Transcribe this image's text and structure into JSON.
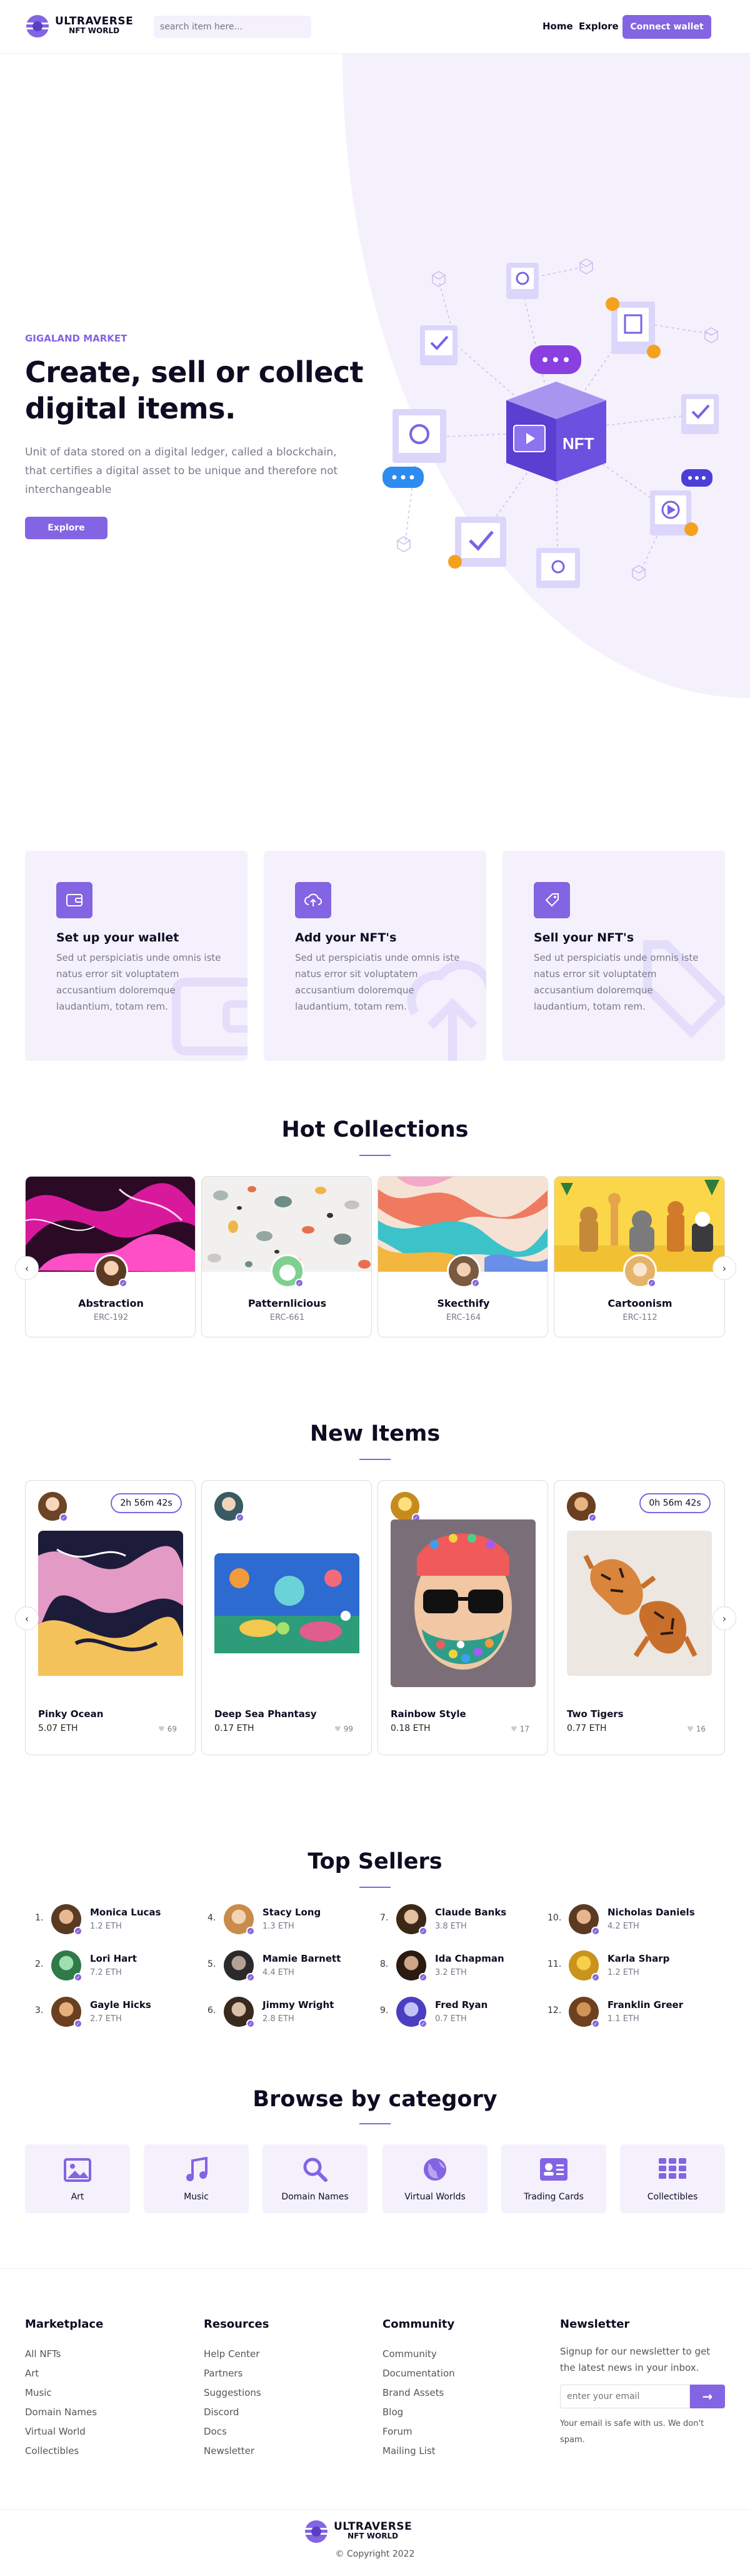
{
  "brand": {
    "line1": "ULTRAVERSE",
    "line2": "NFT WORLD"
  },
  "header": {
    "search_placeholder": "search item here...",
    "nav": [
      "Home",
      "Explore"
    ],
    "connect": "Connect wallet"
  },
  "hero": {
    "eyebrow": "GIGALAND MARKET",
    "title_line1": "Create, sell or collect",
    "title_line2": "digital items.",
    "desc": "Unit of data stored on a digital ledger, called a blockchain, that certifies a digital asset to be unique and therefore not interchangeable",
    "button": "Explore",
    "illustration_label": "NFT"
  },
  "features": [
    {
      "title": "Set up your wallet",
      "icon": "wallet-icon",
      "desc": "Sed ut perspiciatis unde omnis iste natus error sit voluptatem accusantium doloremque laudantium, totam rem."
    },
    {
      "title": "Add your NFT's",
      "icon": "cloud-upload-icon",
      "desc": "Sed ut perspiciatis unde omnis iste natus error sit voluptatem accusantium doloremque laudantium, totam rem."
    },
    {
      "title": "Sell your NFT's",
      "icon": "tag-icon",
      "desc": "Sed ut perspiciatis unde omnis iste natus error sit voluptatem accusantium doloremque laudantium, totam rem."
    }
  ],
  "hot": {
    "title": "Hot Collections",
    "items": [
      {
        "name": "Abstraction",
        "sub": "ERC-192"
      },
      {
        "name": "Patternlicious",
        "sub": "ERC-661"
      },
      {
        "name": "Skecthify",
        "sub": "ERC-164"
      },
      {
        "name": "Cartoonism",
        "sub": "ERC-112"
      }
    ]
  },
  "new_items": {
    "title": "New Items",
    "items": [
      {
        "name": "Pinky Ocean",
        "price": "5.07 ETH",
        "likes": "69",
        "timer": "2h 56m 42s"
      },
      {
        "name": "Deep Sea Phantasy",
        "price": "0.17 ETH",
        "likes": "99",
        "timer": ""
      },
      {
        "name": "Rainbow Style",
        "price": "0.18 ETH",
        "likes": "17",
        "timer": ""
      },
      {
        "name": "Two Tigers",
        "price": "0.77 ETH",
        "likes": "16",
        "timer": "0h 56m 42s"
      }
    ]
  },
  "sellers": {
    "title": "Top Sellers",
    "items": [
      {
        "rank": "1.",
        "name": "Monica Lucas",
        "eth": "1.2 ETH"
      },
      {
        "rank": "2.",
        "name": "Lori Hart",
        "eth": "7.2 ETH"
      },
      {
        "rank": "3.",
        "name": "Gayle Hicks",
        "eth": "2.7 ETH"
      },
      {
        "rank": "4.",
        "name": "Stacy Long",
        "eth": "1.3 ETH"
      },
      {
        "rank": "5.",
        "name": "Mamie Barnett",
        "eth": "4.4 ETH"
      },
      {
        "rank": "6.",
        "name": "Jimmy Wright",
        "eth": "2.8 ETH"
      },
      {
        "rank": "7.",
        "name": "Claude Banks",
        "eth": "3.8 ETH"
      },
      {
        "rank": "8.",
        "name": "Ida Chapman",
        "eth": "3.2 ETH"
      },
      {
        "rank": "9.",
        "name": "Fred Ryan",
        "eth": "0.7 ETH"
      },
      {
        "rank": "10.",
        "name": "Nicholas Daniels",
        "eth": "4.2 ETH"
      },
      {
        "rank": "11.",
        "name": "Karla Sharp",
        "eth": "1.2 ETH"
      },
      {
        "rank": "12.",
        "name": "Franklin Greer",
        "eth": "1.1 ETH"
      }
    ]
  },
  "categories": {
    "title": "Browse by category",
    "items": [
      {
        "label": "Art",
        "icon": "image-icon"
      },
      {
        "label": "Music",
        "icon": "music-icon"
      },
      {
        "label": "Domain Names",
        "icon": "search-icon"
      },
      {
        "label": "Virtual Worlds",
        "icon": "globe-icon"
      },
      {
        "label": "Trading Cards",
        "icon": "id-card-icon"
      },
      {
        "label": "Collectibles",
        "icon": "grid-icon"
      }
    ]
  },
  "footer": {
    "cols": [
      {
        "title": "Marketplace",
        "links": [
          "All NFTs",
          "Art",
          "Music",
          "Domain Names",
          "Virtual World",
          "Collectibles"
        ]
      },
      {
        "title": "Resources",
        "links": [
          "Help Center",
          "Partners",
          "Suggestions",
          "Discord",
          "Docs",
          "Newsletter"
        ]
      },
      {
        "title": "Community",
        "links": [
          "Community",
          "Documentation",
          "Brand Assets",
          "Blog",
          "Forum",
          "Mailing List"
        ]
      }
    ],
    "newsletter": {
      "title": "Newsletter",
      "desc": "Signup for our newsletter to get the latest news in your inbox.",
      "placeholder": "enter your email",
      "note": "Your email is safe with us. We don't spam."
    },
    "copyright": "© Copyright 2022"
  },
  "colors": {
    "accent": "#8364e2",
    "light": "#f4f1fd"
  }
}
